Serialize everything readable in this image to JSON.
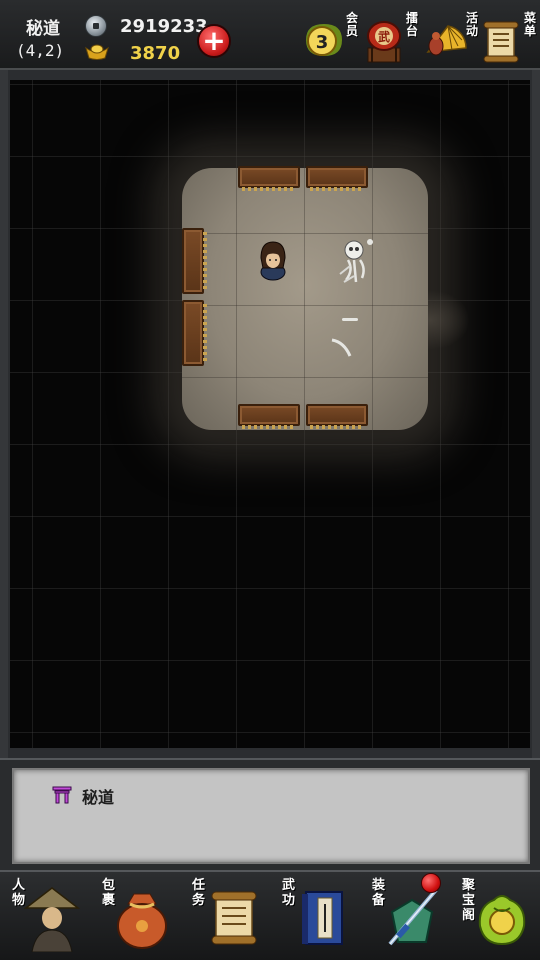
{
  "header": {
    "location_name": "秘道",
    "coordinates": "(4,2)",
    "silver": "2919233",
    "gold": "3870",
    "add_currency_symbol": "+"
  },
  "top_menu": [
    {
      "label": "会员",
      "badge": "3",
      "icon": "vip-medal-icon"
    },
    {
      "label": "擂台",
      "icon": "arena-drum-icon"
    },
    {
      "label": "活动",
      "icon": "event-fan-icon"
    },
    {
      "label": "菜单",
      "icon": "scroll-menu-icon"
    }
  ],
  "message_panel": {
    "icon": "gate-icon",
    "text": "秘道"
  },
  "bottom_nav": [
    {
      "label": "人物",
      "icon": "character-icon"
    },
    {
      "label": "包裹",
      "icon": "bag-icon"
    },
    {
      "label": "任务",
      "icon": "quest-scroll-icon"
    },
    {
      "label": "武功",
      "icon": "martial-book-icon"
    },
    {
      "label": "装备",
      "icon": "equipment-icon",
      "has_notification": true
    },
    {
      "label": "聚宝阁",
      "icon": "treasure-icon"
    }
  ],
  "colors": {
    "gold_text": "#f0d24a",
    "floor": "#8b8375",
    "panel": "#c4c4c4",
    "notification": "#d01010"
  }
}
